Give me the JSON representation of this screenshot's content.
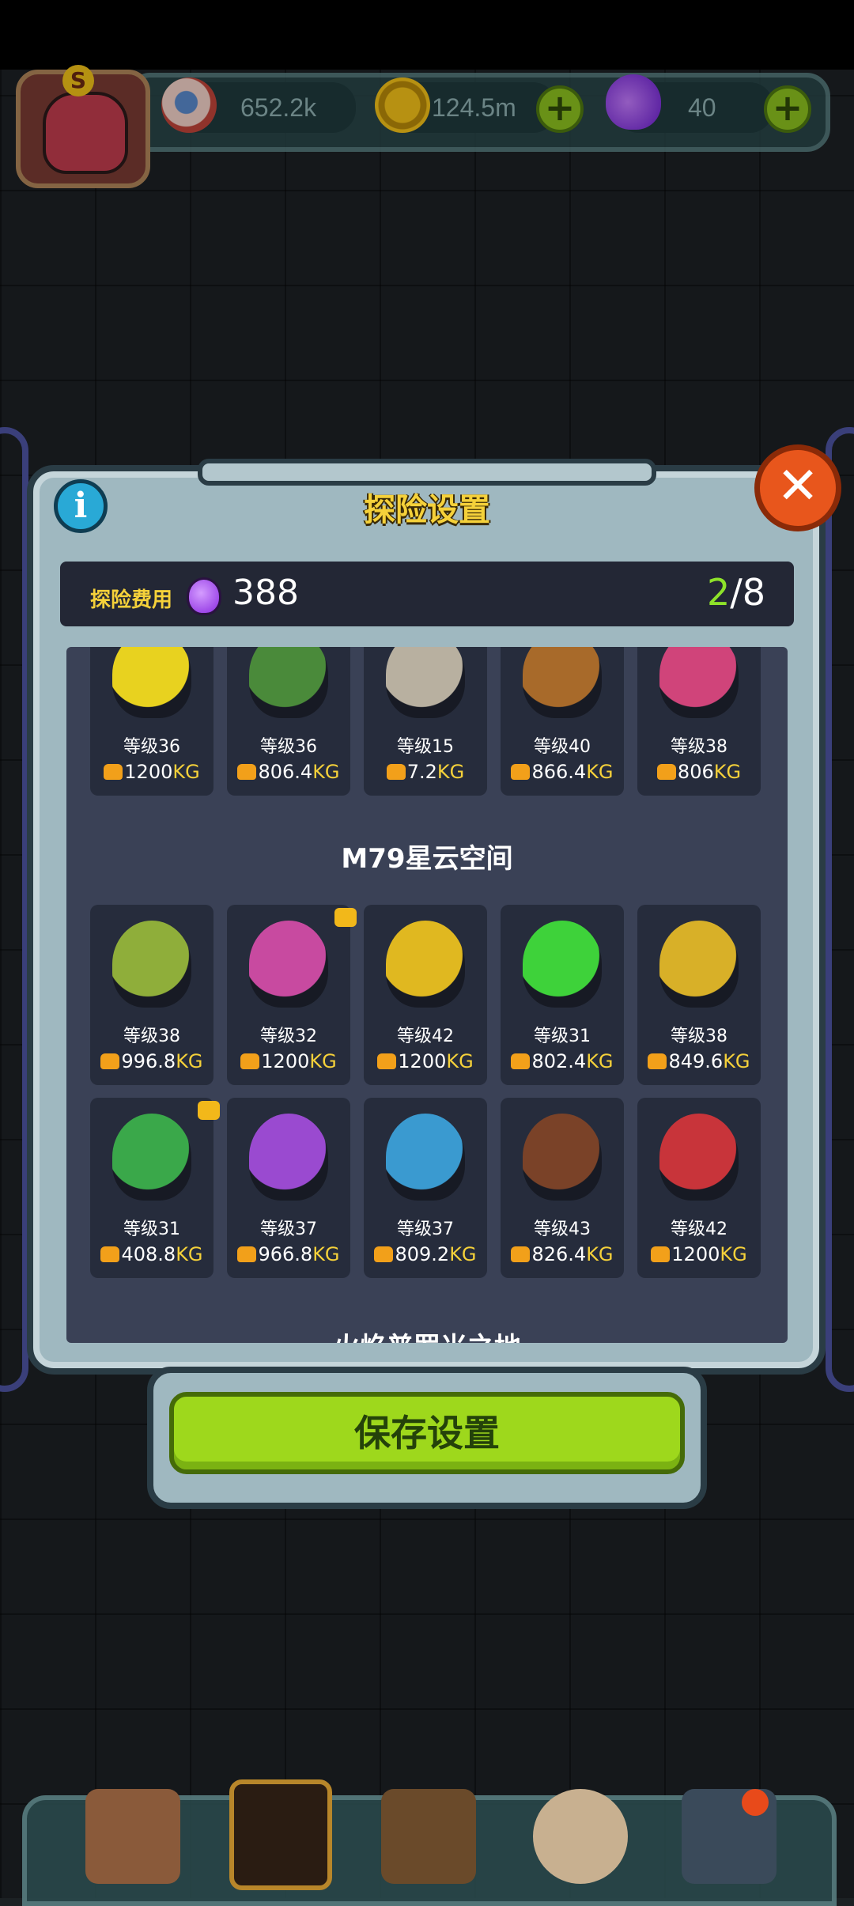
{
  "top_bar": {
    "eyes": "652.2k",
    "coins": "124.5m",
    "potions": "40",
    "avatar_letter": "S"
  },
  "dialog": {
    "title": "探险设置",
    "cost_label": "探险费用",
    "cost_value": "388",
    "slots_current": "2",
    "slots_total": "/8",
    "close_symbol": "✕",
    "info_symbol": "i",
    "save_label": "保存设置"
  },
  "sections": [
    {
      "name": "",
      "cards": [
        {
          "level": "等级36",
          "weight": "1200",
          "unit": "KG",
          "color": "#e8d21f"
        },
        {
          "level": "等级36",
          "weight": "806.4",
          "unit": "KG",
          "color": "#4a8a3a"
        },
        {
          "level": "等级15",
          "weight": "7.2",
          "unit": "KG",
          "color": "#b8b0a0"
        },
        {
          "level": "等级40",
          "weight": "866.4",
          "unit": "KG",
          "color": "#a86a2a"
        },
        {
          "level": "等级38",
          "weight": "806",
          "unit": "KG",
          "color": "#d0447a"
        }
      ]
    },
    {
      "name": "M79星云空间",
      "cards": [
        {
          "level": "等级38",
          "weight": "996.8",
          "unit": "KG",
          "color": "#8fae3a"
        },
        {
          "level": "等级32",
          "weight": "1200",
          "unit": "KG",
          "color": "#c84aa0",
          "badge": true
        },
        {
          "level": "等级42",
          "weight": "1200",
          "unit": "KG",
          "color": "#e0b820"
        },
        {
          "level": "等级31",
          "weight": "802.4",
          "unit": "KG",
          "color": "#3ed23a"
        },
        {
          "level": "等级38",
          "weight": "849.6",
          "unit": "KG",
          "color": "#d8b028"
        },
        {
          "level": "等级31",
          "weight": "408.8",
          "unit": "KG",
          "color": "#3aa84a",
          "badge": true
        },
        {
          "level": "等级37",
          "weight": "966.8",
          "unit": "KG",
          "color": "#9a4ad0"
        },
        {
          "level": "等级37",
          "weight": "809.2",
          "unit": "KG",
          "color": "#3a9ad0"
        },
        {
          "level": "等级43",
          "weight": "826.4",
          "unit": "KG",
          "color": "#7a4228"
        },
        {
          "level": "等级42",
          "weight": "1200",
          "unit": "KG",
          "color": "#c8343a"
        }
      ]
    },
    {
      "name": "火焰普罗米之地"
    }
  ],
  "colors": {
    "accent_yellow": "#f5d13a",
    "accent_green": "#8ee22a",
    "button_green": "#9ed81c"
  },
  "icons": [
    "eye-icon",
    "coin-icon",
    "potion-icon",
    "plus-icon",
    "info-icon",
    "close-icon",
    "kg-weight-icon",
    "shop-icon",
    "monster-icon",
    "book-icon",
    "money-bag-icon",
    "grid-icon"
  ]
}
